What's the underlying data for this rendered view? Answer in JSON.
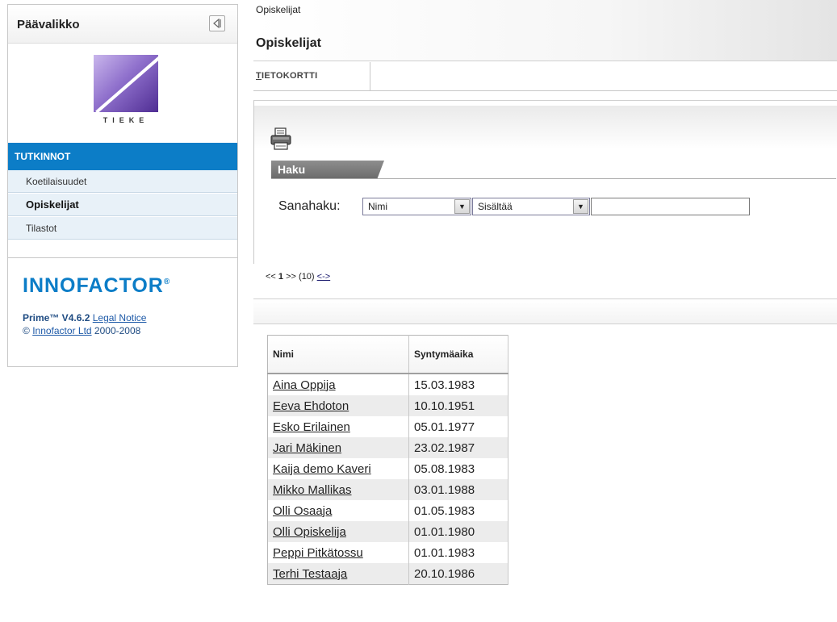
{
  "sidebar": {
    "title": "Päävalikko",
    "logo_text": "TIEKE",
    "section": "TUTKINNOT",
    "items": [
      {
        "label": "Koetilaisuudet"
      },
      {
        "label": "Opiskelijat"
      },
      {
        "label": "Tilastot"
      }
    ],
    "brand": "INNOFACTOR",
    "brand_mark": "®",
    "product": "Prime™ V4.6.2",
    "legal_link": "Legal Notice",
    "copyright_symbol": "©",
    "company_link": "Innofactor Ltd",
    "years": "2000-2008"
  },
  "header": {
    "breadcrumb": "Opiskelijat",
    "title": "Opiskelijat"
  },
  "tabs": {
    "tietokortti_first": "T",
    "tietokortti_rest": "IETOKORTTI"
  },
  "search": {
    "section_label": "Haku",
    "label": "Sanahaku:",
    "field_value": "Nimi",
    "operator_value": "Sisältää",
    "query": ""
  },
  "pager": {
    "prev": "<<",
    "current": "1",
    "next": ">>",
    "count": "(10)",
    "toggle": "<->"
  },
  "table": {
    "headers": [
      "Nimi",
      "Syntymäaika"
    ],
    "rows": [
      [
        "Aina Oppija",
        "15.03.1983"
      ],
      [
        "Eeva Ehdoton",
        "10.10.1951"
      ],
      [
        "Esko Erilainen",
        "05.01.1977"
      ],
      [
        "Jari Mäkinen",
        "23.02.1987"
      ],
      [
        "Kaija demo Kaveri",
        "05.08.1983"
      ],
      [
        "Mikko Mallikas",
        "03.01.1988"
      ],
      [
        "Olli Osaaja",
        "01.05.1983"
      ],
      [
        "Olli Opiskelija",
        "01.01.1980"
      ],
      [
        "Peppi Pitkätossu",
        "01.01.1983"
      ],
      [
        "Terhi Testaaja",
        "20.10.1986"
      ]
    ]
  },
  "colors": {
    "accent": "#0c7dc7",
    "sidebar_item_bg": "#e8f1f8",
    "stripe": "#ececec"
  }
}
